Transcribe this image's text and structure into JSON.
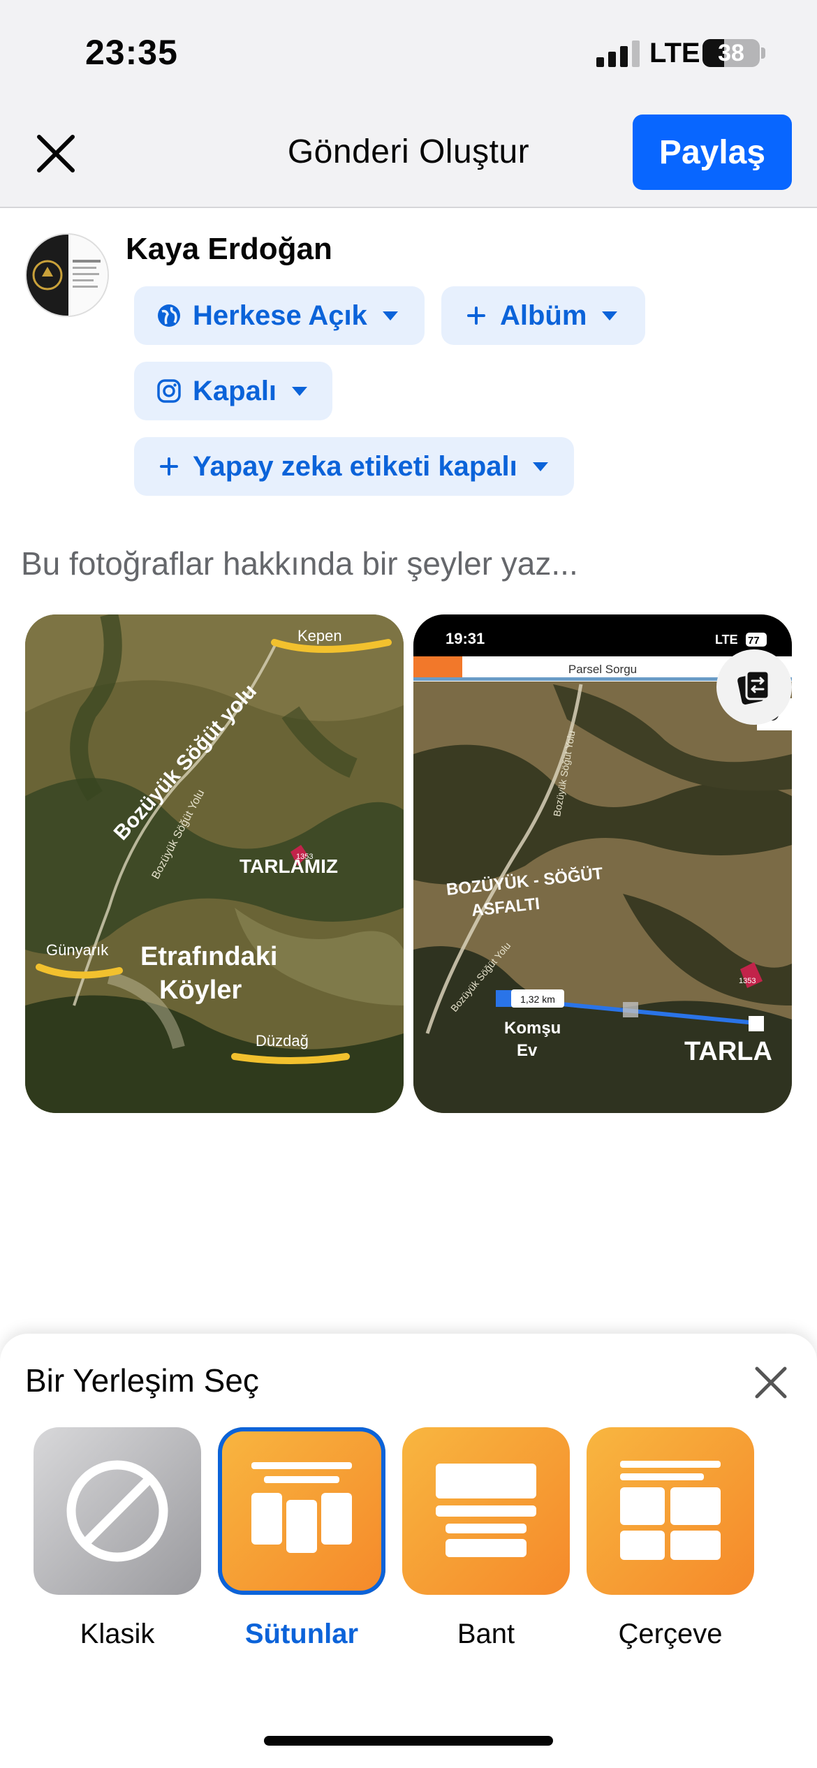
{
  "status_bar": {
    "time": "23:35",
    "network": "LTE",
    "battery": "38",
    "battery_fraction": 0.38
  },
  "header": {
    "title": "Gönderi Oluştur",
    "share_label": "Paylaş"
  },
  "user": {
    "name": "Kaya Erdoğan"
  },
  "audience": {
    "privacy_label": "Herkese Açık",
    "album_label": "Albüm",
    "instagram_label": "Kapalı",
    "ai_label": "Yapay zeka etiketi kapalı"
  },
  "compose": {
    "placeholder": "Bu fotoğraflar hakkında bir şeyler yaz..."
  },
  "photo1": {
    "road_label": "Bozüyük Söğüt yolu",
    "road_small": "Bozüyük Söğüt Yolu",
    "field_label": "TARLAMIZ",
    "villages_label": [
      "Etrafındaki",
      "Köyler"
    ],
    "village_1": "Kepen",
    "village_2": "Günyarık",
    "village_3": "Düzdağ",
    "parcel_code": "1353"
  },
  "photo2": {
    "time": "19:31",
    "network": "LTE",
    "battery": "77",
    "app_title": "Parsel Sorgu",
    "road_small": "Bozüyük Söğüt Yolu",
    "road_label": [
      "BOZÜYÜK - SÖĞÜT",
      "ASFALTI"
    ],
    "distance": "1,32 km",
    "neighbor_label": [
      "Komşu",
      "Ev"
    ],
    "field_label": "TARLA",
    "parcel_code": "1353"
  },
  "layout_sheet": {
    "title": "Bir Yerleşim Seç",
    "options": [
      {
        "label": "Klasik",
        "selected": false
      },
      {
        "label": "Sütunlar",
        "selected": true
      },
      {
        "label": "Bant",
        "selected": false
      },
      {
        "label": "Çerçeve",
        "selected": false
      }
    ]
  },
  "colors": {
    "accent": "#0866ff",
    "pill_bg": "#e7f0fd",
    "pill_text": "#0b63d9",
    "selected_label": "#0b63d9",
    "layout_orange": "#f7a030"
  }
}
